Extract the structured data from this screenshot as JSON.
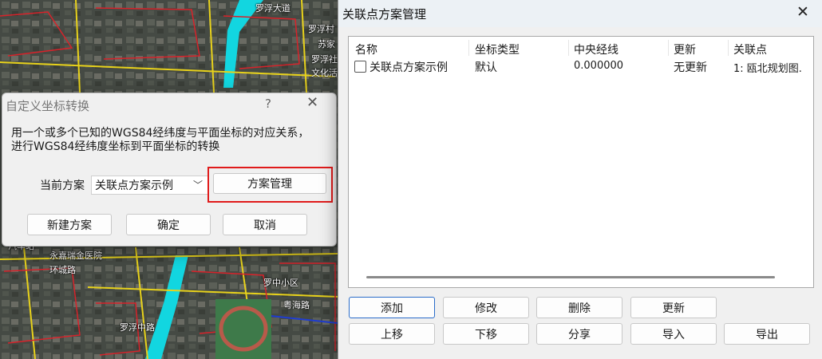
{
  "map": {
    "labels": [
      "罗浮村",
      "苏家",
      "罗浮社",
      "文化活",
      "永嘉瑞金医院",
      "环城路",
      "罗中小区",
      "罗浮中路",
      "粤海路",
      "罗浮大道",
      "汽车站"
    ]
  },
  "custom_dialog": {
    "title": "自定义坐标转换",
    "help_icon": "?",
    "close_icon": "✕",
    "description_line1": "用一个或多个已知的WGS84经纬度与平面坐标的对应关系，",
    "description_line2": "进行WGS84经纬度坐标到平面坐标的转换",
    "current_plan_label": "当前方案",
    "current_plan_value": "关联点方案示例",
    "manage_button": "方案管理",
    "new_plan_button": "新建方案",
    "ok_button": "确定",
    "cancel_button": "取消",
    "highlight_color": "#e01b1b"
  },
  "manager_dialog": {
    "title": "关联点方案管理",
    "close_icon": "✕",
    "columns": [
      "名称",
      "坐标类型",
      "中央经线",
      "更新",
      "关联点"
    ],
    "rows": [
      {
        "name": "关联点方案示例",
        "coord_type": "默认",
        "central_meridian": "0.000000",
        "update": "无更新",
        "points": "1: 瓯北规划图."
      }
    ],
    "buttons_row1": [
      "添加",
      "修改",
      "删除",
      "更新"
    ],
    "buttons_row2": [
      "上移",
      "下移",
      "分享",
      "导入",
      "导出"
    ],
    "accent_color": "#2a6cc9"
  }
}
